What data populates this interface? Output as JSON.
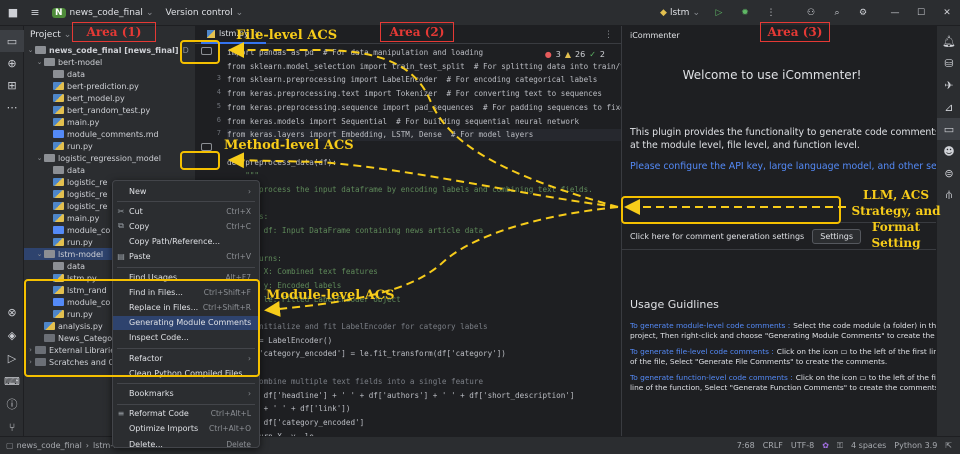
{
  "titlebar": {
    "project_badge": "N",
    "project_name": "news_code_final",
    "vcs": "Version control",
    "run_config": "lstm"
  },
  "project_panel": {
    "header": "Project",
    "tree": [
      {
        "label": "news_code_final [news_final]",
        "suffix": "D",
        "depth": 0,
        "arrow": "⌄",
        "icon": "folder"
      },
      {
        "label": "bert-model",
        "depth": 1,
        "arrow": "⌄",
        "icon": "folder"
      },
      {
        "label": "data",
        "depth": 2,
        "arrow": "",
        "icon": "folder"
      },
      {
        "label": "bert-prediction.py",
        "depth": 2,
        "arrow": "",
        "icon": "py"
      },
      {
        "label": "bert_model.py",
        "depth": 2,
        "arrow": "",
        "icon": "py"
      },
      {
        "label": "bert_random_test.py",
        "depth": 2,
        "arrow": "",
        "icon": "py"
      },
      {
        "label": "main.py",
        "depth": 2,
        "arrow": "",
        "icon": "py"
      },
      {
        "label": "module_comments.md",
        "depth": 2,
        "arrow": "",
        "icon": "md"
      },
      {
        "label": "run.py",
        "depth": 2,
        "arrow": "",
        "icon": "py"
      },
      {
        "label": "logistic_regression_model",
        "depth": 1,
        "arrow": "⌄",
        "icon": "folder"
      },
      {
        "label": "data",
        "depth": 2,
        "arrow": "",
        "icon": "folder"
      },
      {
        "label": "logistic_re",
        "depth": 2,
        "arrow": "",
        "icon": "py"
      },
      {
        "label": "logistic_re",
        "depth": 2,
        "arrow": "",
        "icon": "py"
      },
      {
        "label": "logistic_re",
        "depth": 2,
        "arrow": "",
        "icon": "py"
      },
      {
        "label": "main.py",
        "depth": 2,
        "arrow": "",
        "icon": "py"
      },
      {
        "label": "module_co",
        "depth": 2,
        "arrow": "",
        "icon": "md"
      },
      {
        "label": "run.py",
        "depth": 2,
        "arrow": "",
        "icon": "py"
      },
      {
        "label": "lstm-model",
        "depth": 1,
        "arrow": "⌄",
        "icon": "folder"
      },
      {
        "label": "data",
        "depth": 2,
        "arrow": "",
        "icon": "folder"
      },
      {
        "label": "lstm.py",
        "depth": 2,
        "arrow": "",
        "icon": "py"
      },
      {
        "label": "lstm_rand",
        "depth": 2,
        "arrow": "",
        "icon": "py"
      },
      {
        "label": "module_co",
        "depth": 2,
        "arrow": "",
        "icon": "md"
      },
      {
        "label": "run.py",
        "depth": 2,
        "arrow": "",
        "icon": "py"
      },
      {
        "label": "analysis.py",
        "depth": 1,
        "arrow": "",
        "icon": "py"
      },
      {
        "label": "News_Catego",
        "depth": 1,
        "arrow": "",
        "icon": "lib"
      },
      {
        "label": "External Librarie",
        "depth": 0,
        "arrow": "›",
        "icon": "lib"
      },
      {
        "label": "Scratches and C",
        "depth": 0,
        "arrow": "›",
        "icon": "lib"
      }
    ]
  },
  "editor": {
    "tab": "lstm.py",
    "inspections": {
      "errors": "3",
      "warnings": "26",
      "ok": "2"
    },
    "lines": [
      {
        "no": "",
        "text": "import pandas as pd  # For data manipulation and loading"
      },
      {
        "no": "",
        "text": "from sklearn.model_selection import train_test_split  # For splitting data into train/t"
      },
      {
        "no": "3",
        "text": "from sklearn.preprocessing import LabelEncoder  # For encoding categorical labels"
      },
      {
        "no": "4",
        "text": "from keras.preprocessing.text import Tokenizer  # For converting text to sequences"
      },
      {
        "no": "5",
        "text": "from keras.preprocessing.sequence import pad_sequences  # For padding sequences to fixe"
      },
      {
        "no": "6",
        "text": "from keras.models import Sequential  # For building sequential neural network"
      },
      {
        "no": "7",
        "text": "from keras.layers import Embedding, LSTM, Dense  # For model layers"
      },
      {
        "no": "",
        "text": ""
      },
      {
        "no": "",
        "text": "def preprocess_data(df):"
      },
      {
        "no": "",
        "text": "    \"\"\""
      },
      {
        "no": "",
        "text": "    Preprocess the input dataframe by encoding labels and combining text fields."
      },
      {
        "no": "",
        "text": ""
      },
      {
        "no": "",
        "text": "    Args:"
      },
      {
        "no": "",
        "text": "        df: Input DataFrame containing news article data"
      },
      {
        "no": "",
        "text": ""
      },
      {
        "no": "",
        "text": "    Returns:"
      },
      {
        "no": "",
        "text": "        X: Combined text features"
      },
      {
        "no": "",
        "text": "        y: Encoded labels"
      },
      {
        "no": "",
        "text": "        le: Fitted LabelEncoder object"
      },
      {
        "no": "",
        "text": "    \"\"\""
      },
      {
        "no": "",
        "text": "    # Initialize and fit LabelEncoder for category labels"
      },
      {
        "no": "",
        "text": "    le = LabelEncoder()"
      },
      {
        "no": "",
        "text": "    df['category_encoded'] = le.fit_transform(df['category'])"
      },
      {
        "no": "",
        "text": ""
      },
      {
        "no": "",
        "text": "    # Combine multiple text fields into a single feature"
      },
      {
        "no": "",
        "text": "    X = df['headline'] + ' ' + df['authors'] + ' ' + df['short_description']"
      },
      {
        "no": "",
        "text": "        + ' ' + df['link'])"
      },
      {
        "no": "",
        "text": "    y = df['category_encoded']"
      },
      {
        "no": "",
        "text": "    return X, y, le"
      }
    ]
  },
  "context_menu": {
    "items": [
      {
        "label": "New",
        "shortcut": "",
        "icon": "",
        "arrow": "›",
        "sep_before": false
      },
      {
        "label": "Cut",
        "shortcut": "Ctrl+X",
        "icon": "✂",
        "arrow": "",
        "sep_before": true
      },
      {
        "label": "Copy",
        "shortcut": "Ctrl+C",
        "icon": "⧉",
        "arrow": "",
        "sep_before": false
      },
      {
        "label": "Copy Path/Reference...",
        "shortcut": "",
        "icon": "",
        "arrow": "",
        "sep_before": false
      },
      {
        "label": "Paste",
        "shortcut": "Ctrl+V",
        "icon": "▤",
        "arrow": "",
        "sep_before": false
      },
      {
        "label": "Find Usages",
        "shortcut": "Alt+F7",
        "icon": "",
        "arrow": "",
        "sep_before": true
      },
      {
        "label": "Find in Files...",
        "shortcut": "Ctrl+Shift+F",
        "icon": "",
        "arrow": "",
        "sep_before": false
      },
      {
        "label": "Replace in Files...",
        "shortcut": "Ctrl+Shift+R",
        "icon": "",
        "arrow": "",
        "sep_before": false
      },
      {
        "label": "Generating Module Comments",
        "shortcut": "",
        "icon": "",
        "arrow": "",
        "sep_before": false,
        "selected": true
      },
      {
        "label": "Inspect Code...",
        "shortcut": "",
        "icon": "",
        "arrow": "",
        "sep_before": false
      },
      {
        "label": "Refactor",
        "shortcut": "",
        "icon": "",
        "arrow": "›",
        "sep_before": true
      },
      {
        "label": "Clean Python Compiled Files",
        "shortcut": "",
        "icon": "",
        "arrow": "",
        "sep_before": false
      },
      {
        "label": "Bookmarks",
        "shortcut": "",
        "icon": "",
        "arrow": "›",
        "sep_before": true
      },
      {
        "label": "Reformat Code",
        "shortcut": "Ctrl+Alt+L",
        "icon": "≡",
        "arrow": "",
        "sep_before": true
      },
      {
        "label": "Optimize Imports",
        "shortcut": "Ctrl+Alt+O",
        "icon": "",
        "arrow": "",
        "sep_before": false
      },
      {
        "label": "Delete...",
        "shortcut": "Delete",
        "icon": "",
        "arrow": "",
        "sep_before": false
      }
    ]
  },
  "icommenter": {
    "panel_title": "iCommenter",
    "welcome": "Welcome to use iCommenter!",
    "intro": "This plugin provides the functionality to generate code comments at the module level, file level, and function level.",
    "configure": "Please configure the API key, large language model, and other settings.",
    "settings_prompt": "Click here for comment generation settings",
    "settings_button": "Settings",
    "usage_title": "Usage Guidlines",
    "guides": [
      {
        "head": "To generate module-level code comments :",
        "body": "Select the code module (a folder) in the project, Then right-click and choose \"Generating Module Comments\" to create the comments."
      },
      {
        "head": "To generate file-level code comments :",
        "body": "Click on the icon ▭ to the left of the first line of the file, Select \"Generate File Comments\" to create the comments."
      },
      {
        "head": "To generate function-level code comments :",
        "body": "Click on the icon ▭ to the left of the first line of the function, Select \"Generate Function Comments\" to create the comments."
      }
    ]
  },
  "statusbar": {
    "breadcrumb_root": "news_code_final",
    "breadcrumb_next": "lstm-m",
    "position": "7:68",
    "line_sep": "CRLF",
    "encoding": "UTF-8",
    "indent": "4 spaces",
    "interpreter": "Python 3.9"
  },
  "overlays": {
    "area1": "Area (1)",
    "area2": "Area (2)",
    "area3": "Area (3)",
    "file_acs": "File-level ACS",
    "method_acs": "Method-level ACS",
    "module_acs": "Module-level ACS",
    "llm_line1": "LLM, ACS",
    "llm_line2": "Strategy, and",
    "llm_line3": "Format Setting"
  },
  "colors": {
    "accent": "#3574f0",
    "annotation_yellow": "#f7cc1a",
    "area_red": "#e53935",
    "ide_bg": "#1e1f22",
    "panel_bg": "#2b2d30"
  }
}
